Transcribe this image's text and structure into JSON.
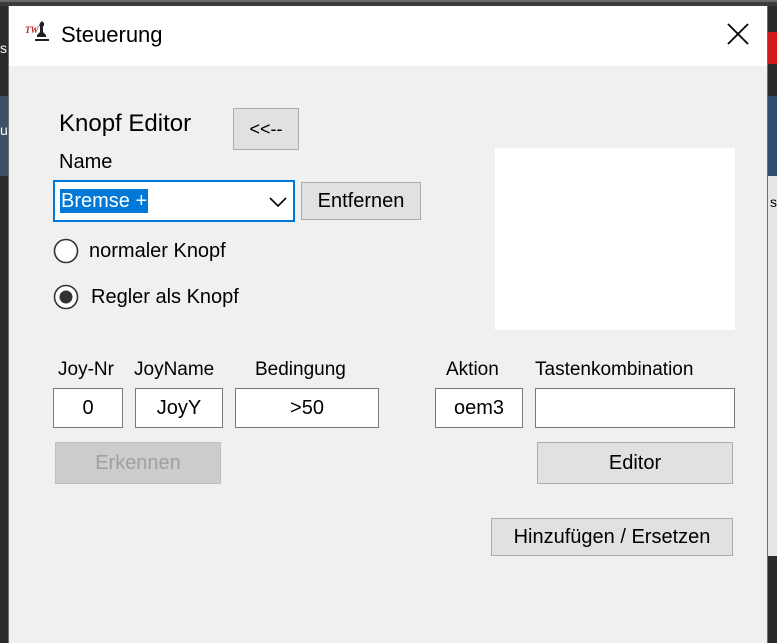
{
  "window": {
    "title": "Steuerung",
    "icon": "app-logo-icon",
    "close_icon": "close-icon"
  },
  "editor": {
    "heading": "Knopf Editor",
    "collapse_button": "<<--",
    "name_label": "Name",
    "name_value": "Bremse +",
    "remove_button": "Entfernen",
    "radio_normal": "normaler Knopf",
    "radio_slider": "Regler als Knopf",
    "selected_radio": "Regler als Knopf"
  },
  "fields": {
    "joy_nr_label": "Joy-Nr",
    "joy_nr_value": "0",
    "joy_name_label": "JoyName",
    "joy_name_value": "JoyY",
    "condition_label": "Bedingung",
    "condition_value": ">50",
    "action_label": "Aktion",
    "action_value": "oem3",
    "keycombo_label": "Tastenkombination",
    "keycombo_value": ""
  },
  "buttons": {
    "detect": "Erkennen",
    "editor": "Editor",
    "add_replace": "Hinzufügen / Ersetzen"
  },
  "background": {
    "left_char_1": "s",
    "left_char_2": "u",
    "right_char": "s"
  },
  "colors": {
    "selection": "#0078d7",
    "dialog_bg": "#f0f0f0",
    "disabled_text": "#a0a0a0"
  }
}
